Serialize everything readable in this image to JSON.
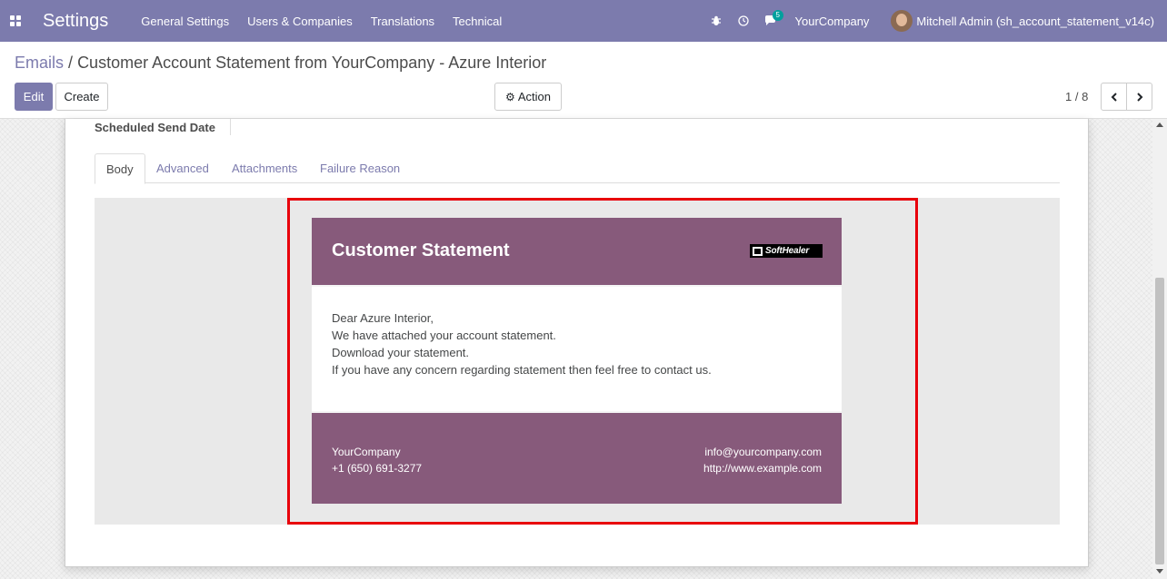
{
  "navbar": {
    "app_title": "Settings",
    "menu": [
      "General Settings",
      "Users & Companies",
      "Translations",
      "Technical"
    ],
    "messages_count": "5",
    "company": "YourCompany",
    "user": "Mitchell Admin (sh_account_statement_v14c)",
    "bg_color": "#7c7bad"
  },
  "breadcrumb": {
    "parent": "Emails",
    "separator": "/",
    "current": "Customer Account Statement from YourCompany - Azure Interior"
  },
  "toolbar": {
    "edit_label": "Edit",
    "create_label": "Create",
    "action_label": "Action",
    "pager": "1 / 8"
  },
  "form": {
    "scheduled_label": "Scheduled Send Date",
    "tabs": [
      "Body",
      "Advanced",
      "Attachments",
      "Failure Reason"
    ],
    "active_tab": "Body"
  },
  "email": {
    "title": "Customer Statement",
    "logo_text": "SoftHealer",
    "body_lines": [
      "Dear Azure Interior,",
      "We have attached your account statement.",
      "Download your statement.",
      "If you have any concern regarding statement then feel free to contact us."
    ],
    "footer": {
      "company": "YourCompany",
      "phone": "+1 (650) 691-3277",
      "email": "info@yourcompany.com",
      "website": "http://www.example.com"
    },
    "accent_color": "#875a7b",
    "highlight_color": "#e8000b"
  }
}
